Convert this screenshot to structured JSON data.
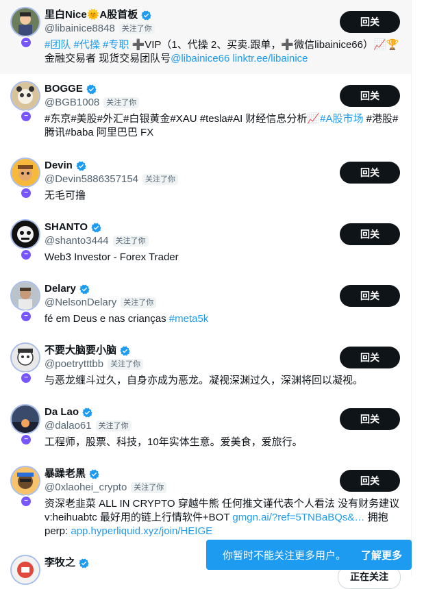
{
  "users": [
    {
      "name": "里白Nice🌞A股首板",
      "handle": "@libainice8848",
      "follows": "关注了你",
      "button": "回关",
      "bio_plain": "",
      "bio_link1": "#团队 #代操 #专职",
      "bio_mid": " ➕VIP（1、代操 2、买卖.跟单，➕微信libainice66）📈🏆金融交易者 现货交易团队号",
      "bio_link2": "@libainice66 linktr.ee/libainice",
      "bio_end": ""
    },
    {
      "name": "BOGGE",
      "handle": "@BGB1008",
      "follows": "关注了你",
      "button": "回关",
      "bio_plain": "#东京#美股#外汇#白银黄金#XAU #tesla#AI 财经信息分析📈",
      "bio_link1": "#A股市场",
      "bio_mid": " #港股#腾讯#baba 阿里巴巴 FX",
      "bio_link2": "",
      "bio_end": ""
    },
    {
      "name": "Devin",
      "handle": "@Devin5886357154",
      "follows": "关注了你",
      "button": "回关",
      "bio_plain": "无毛可撸",
      "bio_link1": "",
      "bio_mid": "",
      "bio_link2": "",
      "bio_end": ""
    },
    {
      "name": "SHANTO",
      "handle": "@shanto3444",
      "follows": "关注了你",
      "button": "回关",
      "bio_plain": "Web3 Investor - Forex Trader",
      "bio_link1": "",
      "bio_mid": "",
      "bio_link2": "",
      "bio_end": ""
    },
    {
      "name": "Delary",
      "handle": "@NelsonDelary",
      "follows": "关注了你",
      "button": "回关",
      "bio_plain": "fé em Deus e nas crianças ",
      "bio_link1": "#meta5k",
      "bio_mid": "",
      "bio_link2": "",
      "bio_end": ""
    },
    {
      "name": "不要大脑要小脑",
      "handle": "@poetrytttbb",
      "follows": "关注了你",
      "button": "回关",
      "bio_plain": "与恶龙缠斗过久，自身亦成为恶龙。凝视深渊过久，深渊将回以凝视。",
      "bio_link1": "",
      "bio_mid": "",
      "bio_link2": "",
      "bio_end": ""
    },
    {
      "name": "Da Lao",
      "handle": "@dalao61",
      "follows": "关注了你",
      "button": "回关",
      "bio_plain": "工程师，股票、科技，10年实体生意。爱美食，爱旅行。",
      "bio_link1": "",
      "bio_mid": "",
      "bio_link2": "",
      "bio_end": ""
    },
    {
      "name": "暴躁老黑",
      "handle": "@0xlaohei_crypto",
      "follows": "关注了你",
      "button": "回关",
      "bio_plain": "资深老韭菜 ALL IN CRYPTO 穿越牛熊 任何推文谨代表个人看法 没有财务建议 v:heihuabtc 最好用的链上行情软件+BOT ",
      "bio_link1": "gmgn.ai/?ref=5TNBaBQs&…",
      "bio_mid": " 拥抱perp: ",
      "bio_link2": "app.hyperliquid.xyz/join/HEIGE",
      "bio_end": ""
    },
    {
      "name": "李牧之",
      "handle": "",
      "follows": "",
      "button": "正在关注",
      "bio_plain": "",
      "bio_link1": "",
      "bio_mid": "",
      "bio_link2": "",
      "bio_end": ""
    }
  ],
  "toast": {
    "message": "你暂时不能关注更多用户。",
    "action": "了解更多"
  },
  "colors": {
    "accent": "#1d9bf0",
    "button": "#0f1419",
    "badge": "#7856ff"
  },
  "icons": {
    "verified": "verified-check-icon",
    "badge": "community-badge-icon"
  }
}
